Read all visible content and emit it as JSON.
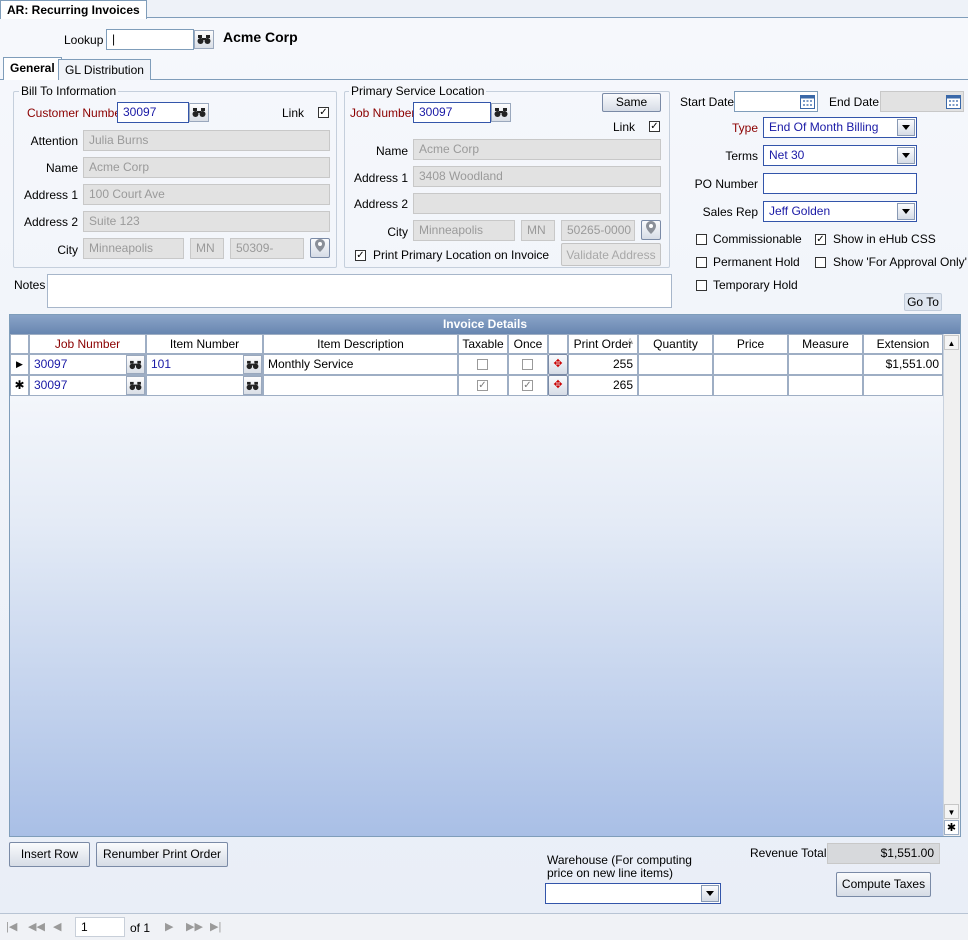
{
  "window": {
    "tab_title": "AR: Recurring Invoices"
  },
  "lookup": {
    "label": "Lookup",
    "value": "|",
    "display_name": "Acme Corp"
  },
  "tabs": [
    {
      "label": "General"
    },
    {
      "label": "GL Distribution"
    }
  ],
  "bill_to": {
    "title": "Bill To Information",
    "customer_number_label": "Customer Number",
    "customer_number": "30097",
    "link_label": "Link",
    "attention_label": "Attention",
    "attention": "Julia Burns",
    "name_label": "Name",
    "name": "Acme Corp",
    "address1_label": "Address 1",
    "address1": "100 Court Ave",
    "address2_label": "Address 2",
    "address2": "Suite 123",
    "city_label": "City",
    "city": "Minneapolis",
    "state": "MN",
    "zip": "50309-"
  },
  "service": {
    "title": "Primary Service Location",
    "job_number_label": "Job Number",
    "job_number": "30097",
    "same_label": "Same",
    "link_label": "Link",
    "name_label": "Name",
    "name": "Acme Corp",
    "address1_label": "Address 1",
    "address1": "3408 Woodland",
    "address2_label": "Address 2",
    "address2": "",
    "city_label": "City",
    "city": "Minneapolis",
    "state": "MN",
    "zip": "50265-0000",
    "print_label": "Print Primary Location on Invoice",
    "validate_label": "Validate Address"
  },
  "right": {
    "start_date_label": "Start Date",
    "start_date": "",
    "end_date_label": "End Date",
    "end_date": "",
    "type_label": "Type",
    "type": "End Of Month Billing",
    "terms_label": "Terms",
    "terms": "Net 30",
    "po_label": "PO Number",
    "po": "",
    "sales_rep_label": "Sales Rep",
    "sales_rep": "Jeff Golden",
    "commissionable": "Commissionable",
    "show_ehub": "Show in eHub CSS",
    "permanent_hold": "Permanent Hold",
    "show_approval": "Show 'For Approval Only'",
    "temporary_hold": "Temporary Hold",
    "goto": "Go To"
  },
  "notes": {
    "label": "Notes",
    "value": ""
  },
  "invoice": {
    "title": "Invoice Details",
    "columns": [
      "Job Number",
      "Item Number",
      "Item Description",
      "Taxable",
      "Once",
      "Print Order",
      "Quantity",
      "Price",
      "Measure",
      "Extension"
    ],
    "rows": [
      {
        "job": "30097",
        "item": "101",
        "desc": "Monthly Service",
        "print_order": "255",
        "quantity": "",
        "price": "",
        "measure": "",
        "extension": "$1,551.00"
      },
      {
        "job": "30097",
        "item": "",
        "desc": "",
        "print_order": "265",
        "quantity": "",
        "price": "",
        "measure": "",
        "extension": ""
      }
    ]
  },
  "bottom": {
    "insert_row": "Insert Row",
    "renumber": "Renumber Print Order",
    "warehouse_label_1": "Warehouse (For computing",
    "warehouse_label_2": "price on new line items)",
    "warehouse": "",
    "revenue_label": "Revenue Total",
    "revenue": "$1,551.00",
    "compute_taxes": "Compute Taxes"
  },
  "pager": {
    "page": "1",
    "of": "of 1"
  }
}
